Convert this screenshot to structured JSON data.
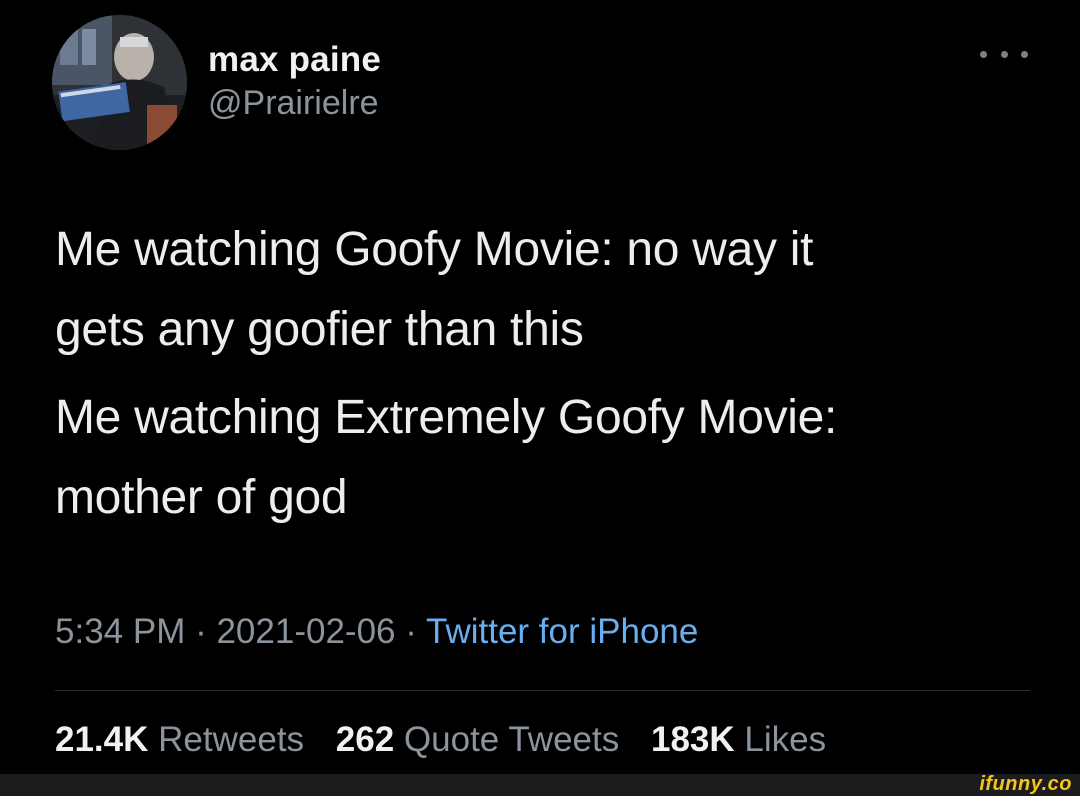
{
  "author": {
    "display_name": "max paine",
    "handle": "@Prairielre"
  },
  "tweet": {
    "lines": [
      "Me watching Goofy Movie: no way it",
      "gets any goofier than this",
      "Me watching Extremely Goofy Movie:",
      "mother of god"
    ]
  },
  "meta": {
    "time": "5:34 PM",
    "separator": " · ",
    "date": "2021-02-06",
    "source": "Twitter for iPhone"
  },
  "stats": {
    "retweets": {
      "count": "21.4K",
      "label": "Retweets"
    },
    "quotes": {
      "count": "262",
      "label": "Quote Tweets"
    },
    "likes": {
      "count": "183K",
      "label": "Likes"
    }
  },
  "watermark": "ifunny.co",
  "colors": {
    "background": "#000000",
    "text": "#ededed",
    "secondary_text": "#8b949c",
    "link": "#6aaef0",
    "watermark": "#f5c518"
  }
}
